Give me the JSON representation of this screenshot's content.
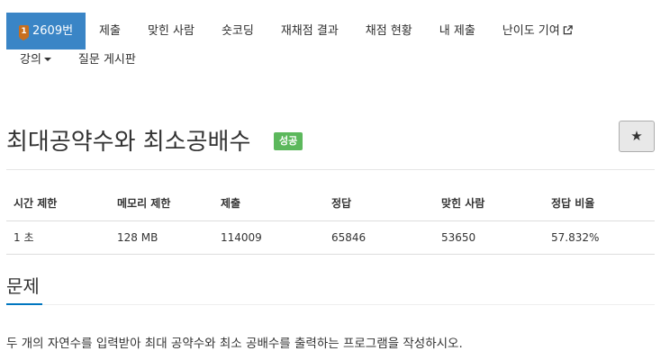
{
  "tabs": {
    "problem": {
      "tier": "1",
      "label": "2609번"
    },
    "row1": [
      "제출",
      "맞힌 사람",
      "숏코딩",
      "재채점 결과",
      "채점 현황",
      "내 제출",
      "난이도 기여"
    ],
    "row2": {
      "lecture": "강의",
      "board": "질문 게시판"
    }
  },
  "title": {
    "text": "최대공약수와 최소공배수",
    "status": "성공",
    "star": "★"
  },
  "info": {
    "headers": [
      "시간 제한",
      "메모리 제한",
      "제출",
      "정답",
      "맞힌 사람",
      "정답 비율"
    ],
    "values": [
      "1 초",
      "128 MB",
      "114009",
      "65846",
      "53650",
      "57.832%"
    ]
  },
  "section": {
    "title": "문제",
    "text": "두 개의 자연수를 입력받아 최대 공약수와 최소 공배수를 출력하는 프로그램을 작성하시오."
  },
  "colors": {
    "accent": "#3a85c6",
    "success": "#5cb85c",
    "tier": "#c86f1f",
    "section_line": "#0076c0"
  }
}
